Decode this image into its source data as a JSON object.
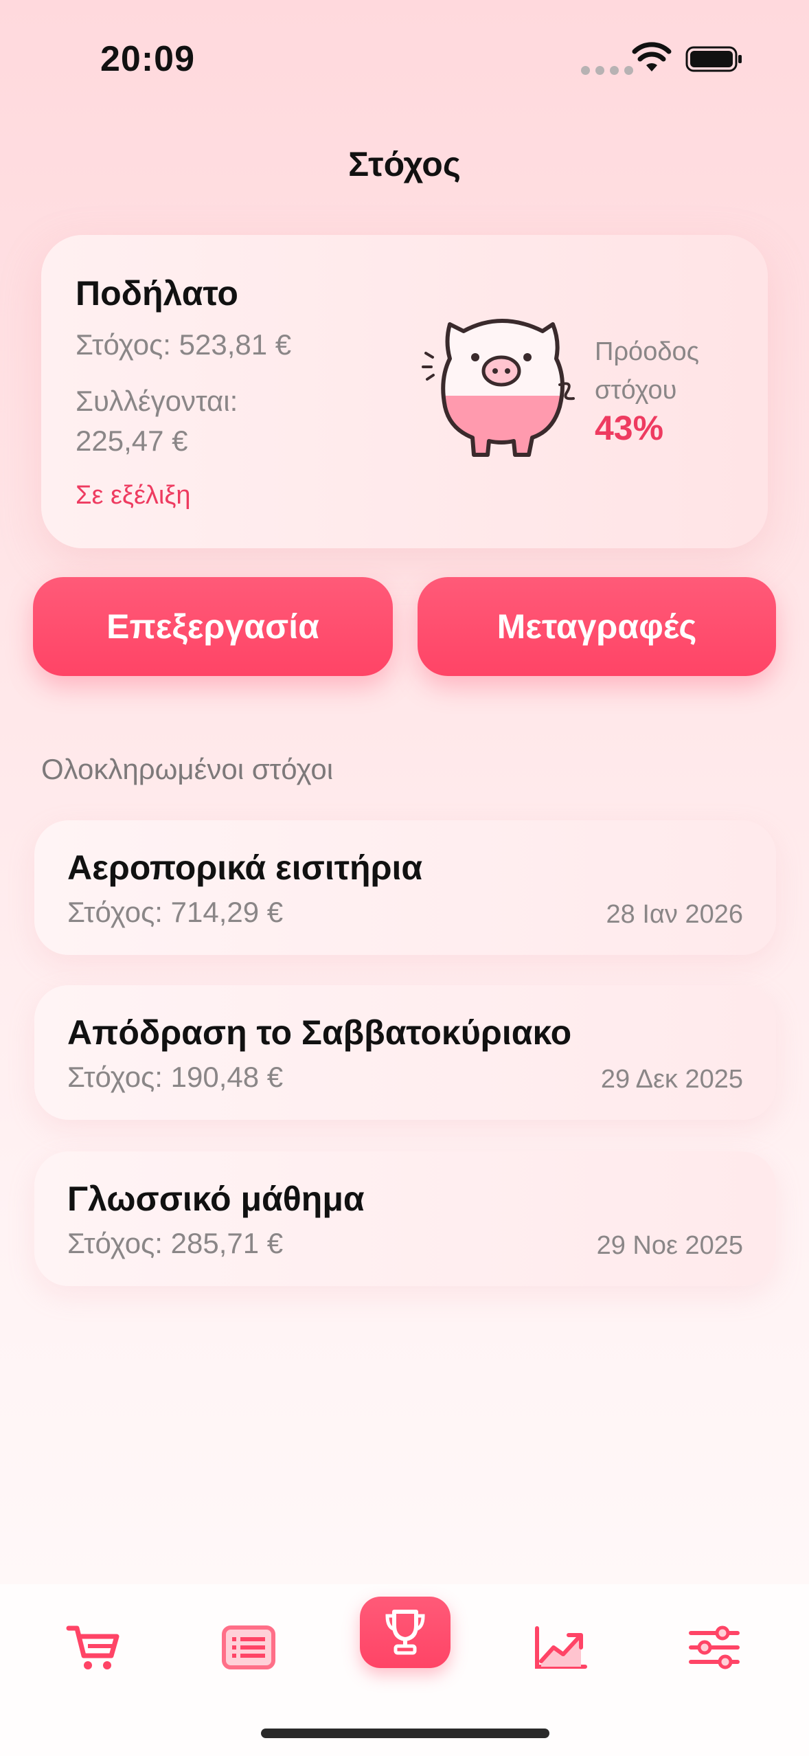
{
  "status_bar": {
    "time": "20:09"
  },
  "header": {
    "title": "Στόχος"
  },
  "current_goal": {
    "name": "Ποδήλατο",
    "target_text": "Στόχος: 523,81 €",
    "collected_label": "Συλλέγονται:",
    "collected_value": "225,47 €",
    "status": "Σε εξέλιξη",
    "progress_label": "Πρόοδος στόχου",
    "progress_value": "43%",
    "progress_fraction": 0.43
  },
  "actions": {
    "edit_label": "Επεξεργασία",
    "transfers_label": "Μεταγραφές"
  },
  "completed": {
    "title": "Ολοκληρωμένοι στόχοι",
    "items": [
      {
        "name": "Αεροπορικά εισιτήρια",
        "target_text": "Στόχος: 714,29 €",
        "date": "28 Ιαν 2026"
      },
      {
        "name": "Απόδραση το Σαββατοκύριακο",
        "target_text": "Στόχος: 190,48 €",
        "date": "29 Δεκ 2025"
      },
      {
        "name": "Γλωσσικό μάθημα",
        "target_text": "Στόχος: 285,71 €",
        "date": "29 Νοε 2025"
      }
    ]
  },
  "tab_bar": {
    "active": "goals",
    "tabs": [
      {
        "id": "cart",
        "icon": "cart-icon"
      },
      {
        "id": "list",
        "icon": "list-icon"
      },
      {
        "id": "goals",
        "icon": "trophy-icon"
      },
      {
        "id": "stats",
        "icon": "chart-icon"
      },
      {
        "id": "settings",
        "icon": "sliders-icon"
      }
    ]
  },
  "colors": {
    "accent": "#ff4466",
    "accent_text": "#ee3b60",
    "muted": "#8a8687"
  }
}
